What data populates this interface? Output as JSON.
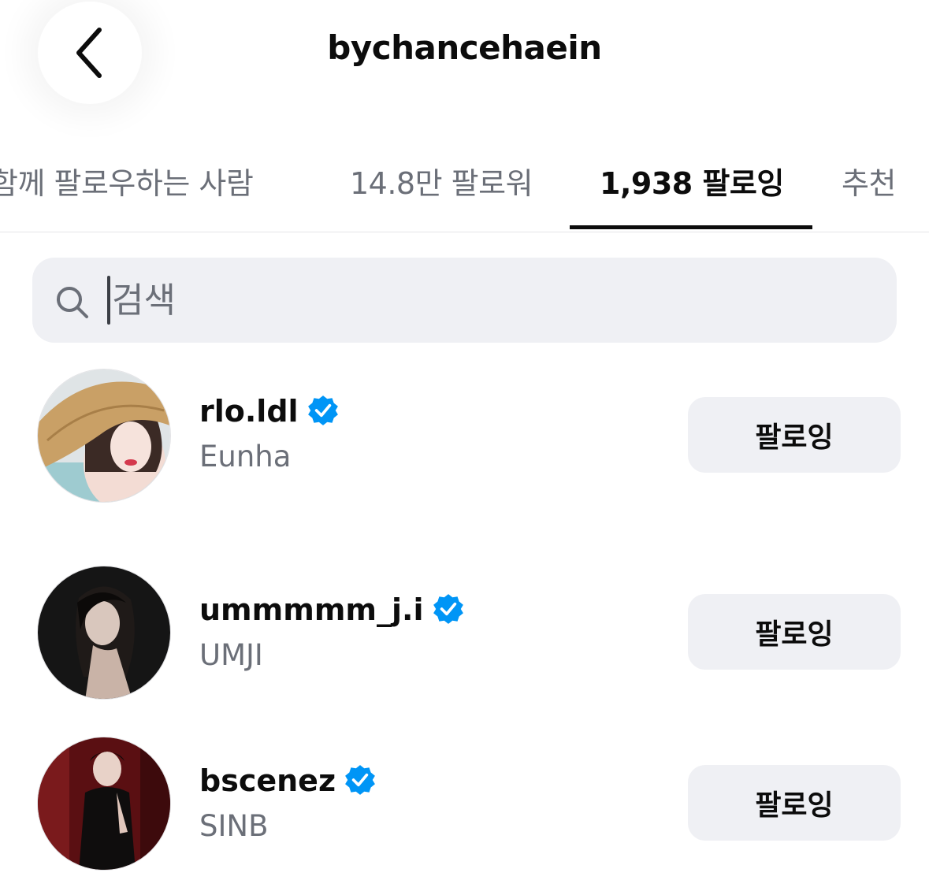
{
  "header": {
    "title": "bychancehaein",
    "back_icon": "chevron-left-icon"
  },
  "tabs": [
    {
      "label": "함께 팔로우하는 사람",
      "active": false
    },
    {
      "label": "14.8만 팔로워",
      "active": false
    },
    {
      "label": "1,938 팔로잉",
      "active": true
    },
    {
      "label": "추천",
      "active": false
    }
  ],
  "search": {
    "placeholder": "검색",
    "value": ""
  },
  "colors": {
    "verified": "#0095f6",
    "button_bg": "#eff0f4",
    "secondary_text": "#6b6f78"
  },
  "users": [
    {
      "username": "rlo.ldl",
      "full_name": "Eunha",
      "verified": true,
      "button_label": "팔로잉"
    },
    {
      "username": "ummmmm_j.i",
      "full_name": "UMJI",
      "verified": true,
      "button_label": "팔로잉"
    },
    {
      "username": "bscenez",
      "full_name": "SINB",
      "verified": true,
      "button_label": "팔로잉"
    }
  ]
}
